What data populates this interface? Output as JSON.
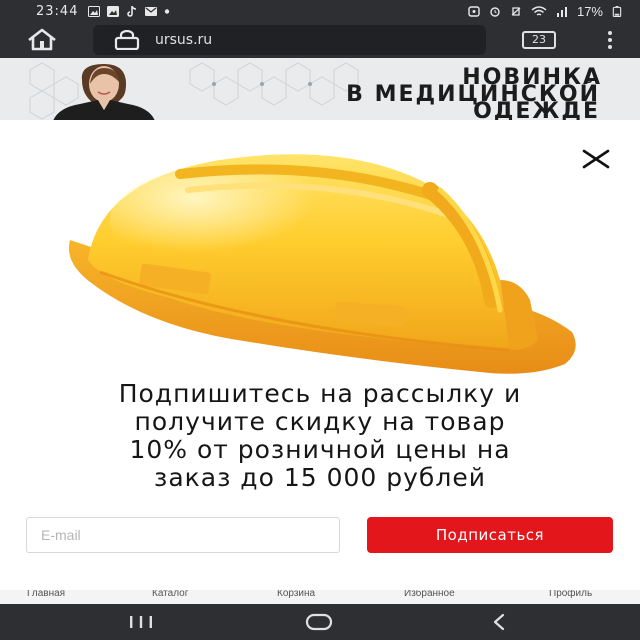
{
  "status_bar": {
    "time": "23:44",
    "battery": "17%",
    "left_icons": [
      "gallery-icon",
      "image-icon",
      "tiktok-icon",
      "mail-icon",
      "dot-icon"
    ],
    "right_icons": [
      "alarm-icon",
      "mute-icon",
      "vibrate-icon",
      "wifi-icon",
      "signal-icon",
      "battery-icon"
    ]
  },
  "browser": {
    "url": "ursus.ru",
    "tab_count": "23"
  },
  "banner": {
    "line1": "НОВИНКА",
    "line2": "В МЕДИЦИНСКОЙ",
    "line3": "ОДЕЖДЕ"
  },
  "modal": {
    "text_lines": [
      "Подпишитесь на рассылку и",
      "получите скидку на товар",
      "10% от розничной цены на",
      "заказ до 15 000 рублей"
    ],
    "email_placeholder": "E-mail",
    "email_value": "",
    "subscribe_label": "Подписаться",
    "accent_color": "#e3161b"
  },
  "bottom_nav": {
    "items": [
      "Главная",
      "Каталог",
      "Корзина",
      "Избранное",
      "Профиль"
    ]
  }
}
